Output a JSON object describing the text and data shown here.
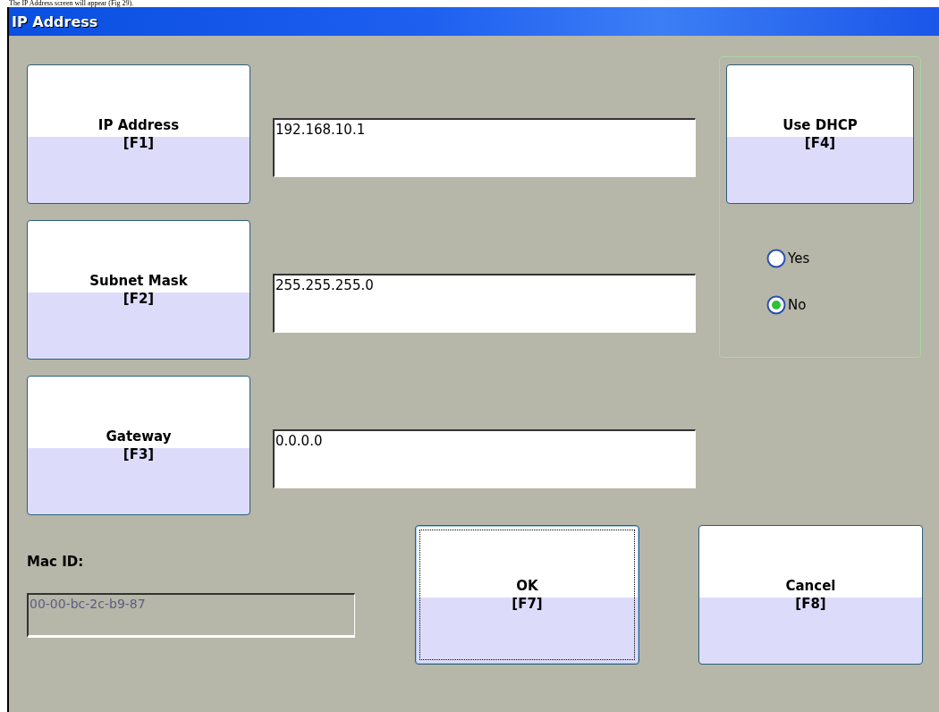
{
  "caption": "The IP Address screen will appear (Fig 29).",
  "window": {
    "title": "IP Address"
  },
  "settings": [
    {
      "button": {
        "label": "IP Address",
        "key": "[F1]"
      },
      "value": "192.168.10.1"
    },
    {
      "button": {
        "label": "Subnet Mask",
        "key": "[F2]"
      },
      "value": "255.255.255.0"
    },
    {
      "button": {
        "label": "Gateway",
        "key": "[F3]"
      },
      "value": "0.0.0.0"
    }
  ],
  "dhcp": {
    "button": {
      "label": "Use DHCP",
      "key": "[F4]"
    },
    "options": [
      {
        "label": "Yes",
        "selected": false
      },
      {
        "label": "No",
        "selected": true
      }
    ]
  },
  "mac": {
    "label": "Mac ID:",
    "value": "00-00-bc-2c-b9-87",
    "disabled": true
  },
  "actions": [
    {
      "label": "OK",
      "key": "[F7]",
      "focused": true
    },
    {
      "label": "Cancel",
      "key": "[F8]",
      "focused": false
    }
  ]
}
